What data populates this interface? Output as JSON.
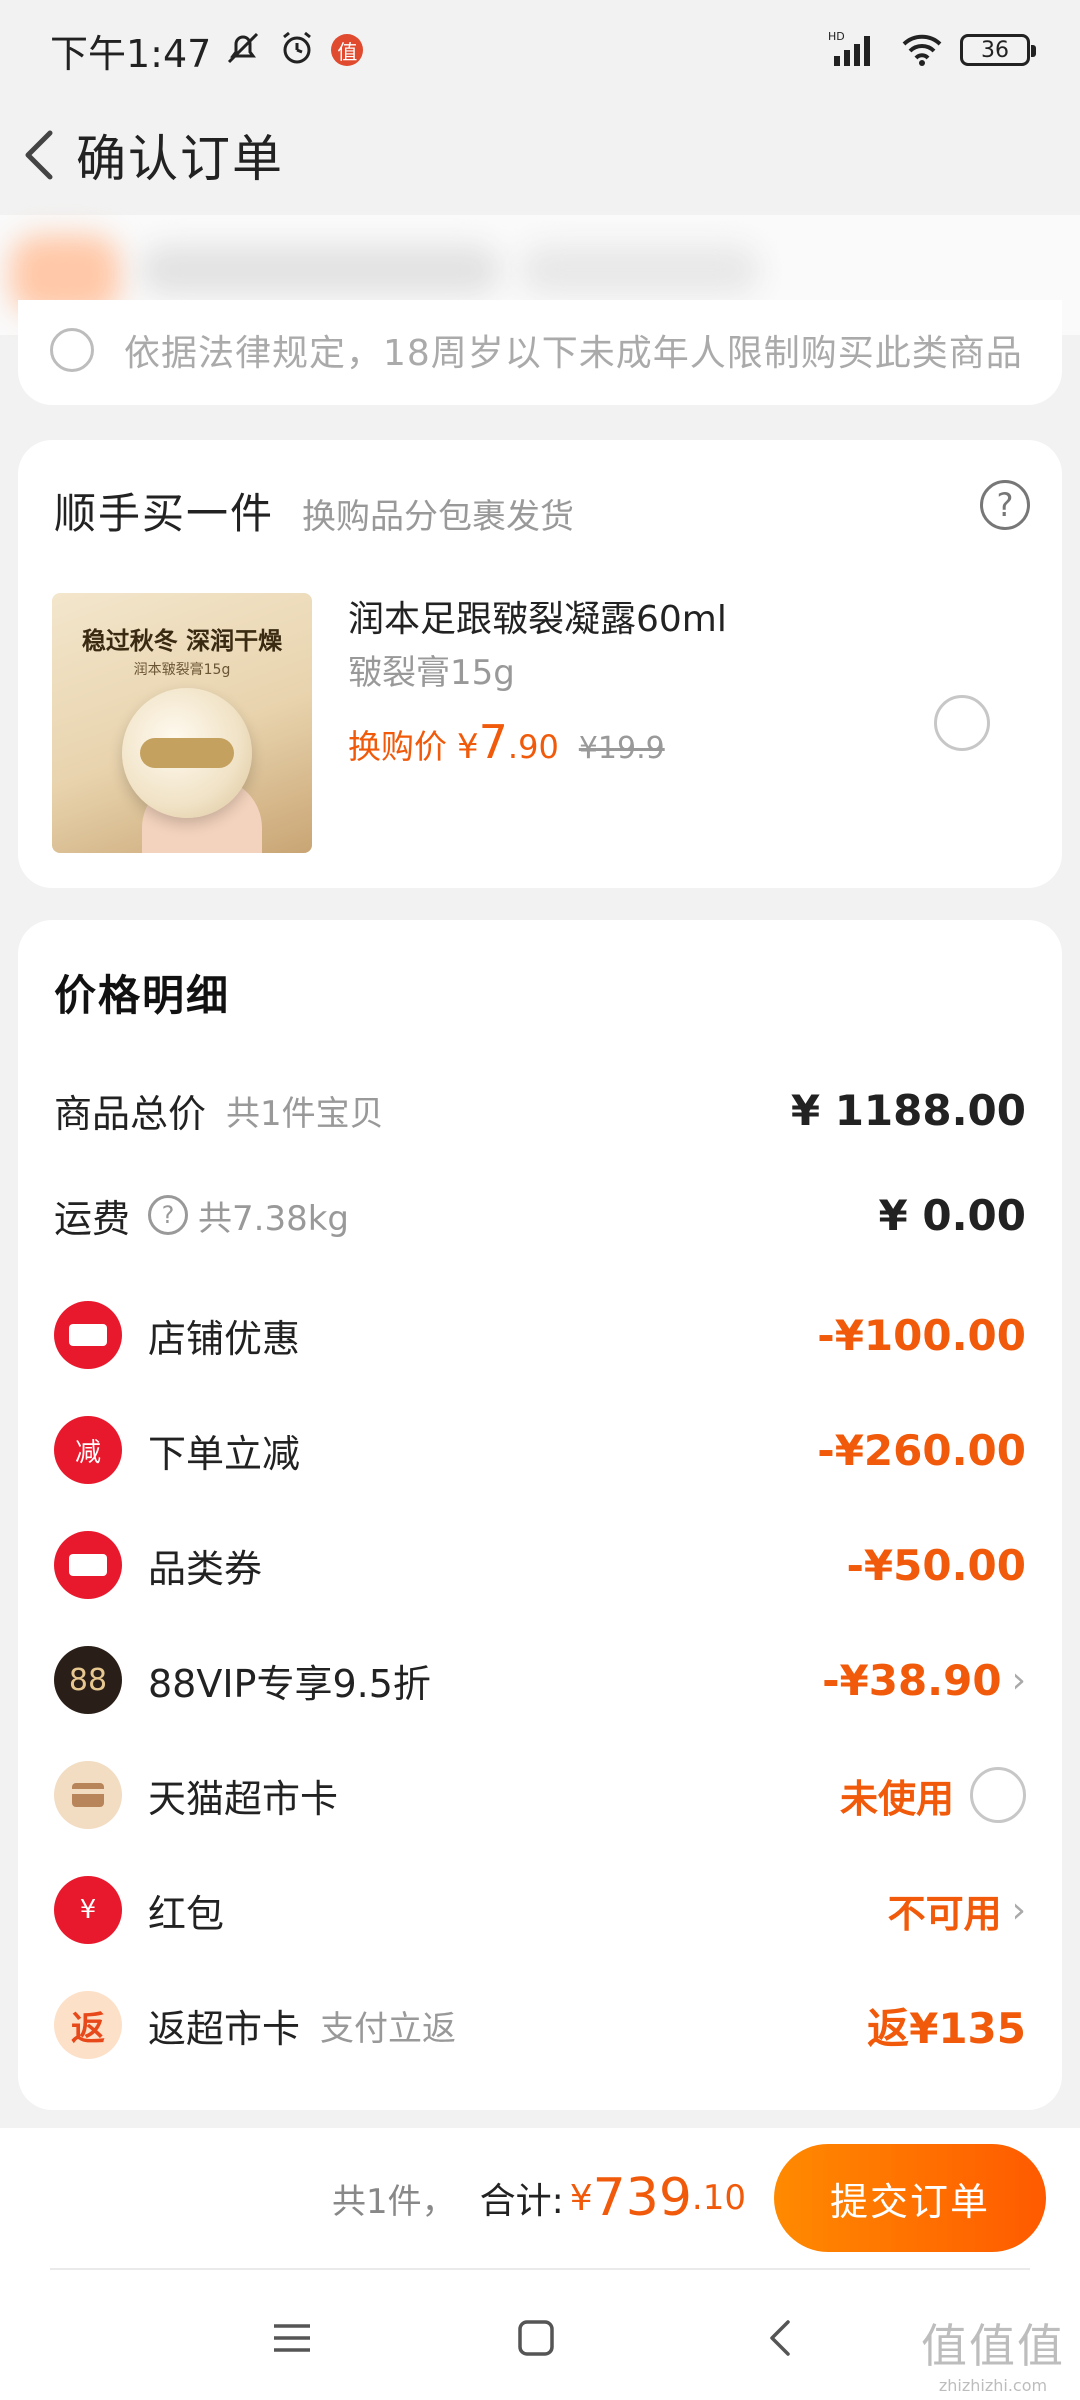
{
  "status_bar": {
    "time": "下午1:47",
    "notification_badge": "值",
    "battery": "36"
  },
  "nav": {
    "title": "确认订单"
  },
  "law_notice": {
    "text": "依据法律规定，18周岁以下未成年人限制购买此类商品"
  },
  "addon": {
    "title": "顺手买一件",
    "subtitle": "换购品分包裹发货",
    "image": {
      "headline": "稳过秋冬 深润干燥",
      "sub": "润本皲裂膏15g"
    },
    "product_name": "润本足跟皲裂凝露60ml",
    "product_spec": "皲裂膏15g",
    "price_label": "换购价",
    "price_yen": "¥",
    "price_int": "7",
    "price_dec": ".90",
    "price_old": "¥19.9"
  },
  "price_detail": {
    "title": "价格明细",
    "rows": [
      {
        "label": "商品总价",
        "sub": "共1件宝贝",
        "value": "¥ 1188.00"
      },
      {
        "label": "运费",
        "sub": "共7.38kg",
        "value": "¥ 0.00"
      },
      {
        "label": "店铺优惠",
        "value": "-¥100.00"
      },
      {
        "label": "下单立减",
        "icon_text": "减",
        "value": "-¥260.00"
      },
      {
        "label": "品类券",
        "value": "-¥50.00"
      },
      {
        "label": "88VIP专享9.5折",
        "icon_text": "88",
        "value": "-¥38.90"
      },
      {
        "label": "天猫超市卡",
        "value": "未使用"
      },
      {
        "label": "红包",
        "icon_text": "¥",
        "value": "不可用"
      },
      {
        "label": "返超市卡",
        "icon_text": "返",
        "sub": "支付立返",
        "value": "返¥135"
      }
    ]
  },
  "bottom_bar": {
    "count": "共1件，",
    "total_label": "合计:",
    "total_yen": "¥",
    "total_int": "739",
    "total_dec": ".10",
    "submit_label": "提交订单"
  },
  "watermark": {
    "glyphs": "值值值",
    "url": "zhizhizhi.com"
  },
  "colors": {
    "accent_orange": "#f05a0a",
    "coupon_red": "#e8192c",
    "background": "#f2f2f2"
  }
}
